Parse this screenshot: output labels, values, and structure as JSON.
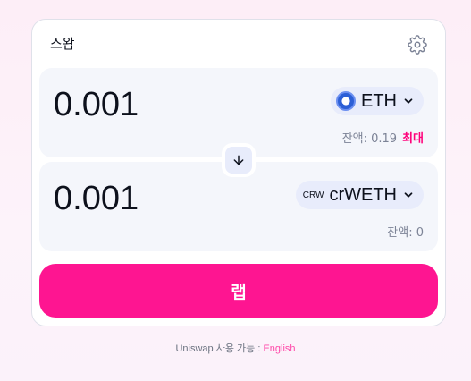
{
  "header": {
    "title": "스왑"
  },
  "input_panel": {
    "amount": "0.001",
    "token_symbol": "ETH",
    "balance_label": "잔액: 0.19",
    "max_label": "최대"
  },
  "output_panel": {
    "amount": "0.001",
    "token_prefix": "CRW",
    "token_symbol": "crWETH",
    "balance_label": "잔액: 0"
  },
  "action_button": {
    "label": "랩"
  },
  "footer": {
    "text": "Uniswap 사용 가능 : ",
    "link": "English"
  },
  "colors": {
    "accent": "#fe1591",
    "max_link": "#ff007a",
    "panel_bg": "#f4f6fb",
    "token_btn_bg": "#e8ecfb"
  },
  "icons": [
    "gear-icon",
    "eth-logo-icon",
    "chevron-down-icon",
    "arrow-down-icon"
  ]
}
